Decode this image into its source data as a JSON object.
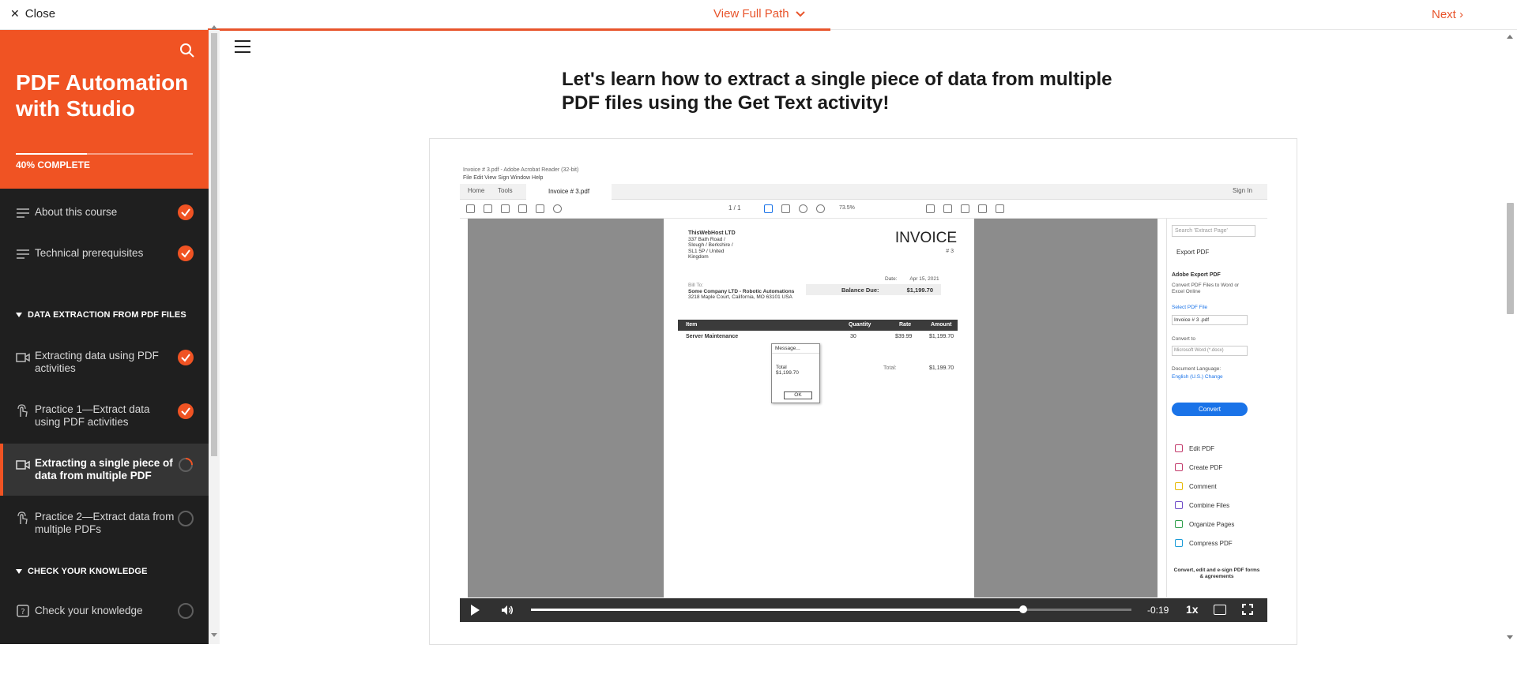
{
  "topbar": {
    "close_label": "Close",
    "view_full_path_label": "View Full Path",
    "next_label": "Next"
  },
  "course": {
    "title": "PDF Automation with Studio",
    "progress_label": "40% COMPLETE",
    "progress_fraction": 0.4
  },
  "sidebar": {
    "items": [
      {
        "label": "About this course",
        "status": "done",
        "icon": "lines-icon"
      },
      {
        "label": "Technical prerequisites",
        "status": "done",
        "icon": "lines-icon"
      },
      {
        "label": "Extracting data using PDF activities",
        "status": "done",
        "icon": "video-icon"
      },
      {
        "label": "Practice 1—Extract data using PDF activities",
        "status": "done",
        "icon": "hand-pointer-icon"
      },
      {
        "label": "Extracting a single piece of data from multiple PDF",
        "status": "in-progress",
        "icon": "video-icon"
      },
      {
        "label": "Practice 2—Extract data from multiple PDFs",
        "status": "open",
        "icon": "hand-pointer-icon"
      },
      {
        "label": "Check your knowledge",
        "status": "open",
        "icon": "quiz-icon"
      }
    ],
    "sections": [
      "DATA EXTRACTION FROM PDF FILES",
      "CHECK YOUR KNOWLEDGE"
    ]
  },
  "lesson": {
    "title": "Let's learn how to extract a single piece of data from multiple PDF files using the Get Text activity!"
  },
  "video": {
    "time_remaining": "-0:19",
    "speed": "1x",
    "progress_fraction": 0.82,
    "acrobat": {
      "window_title": "Invoice # 3.pdf - Adobe Acrobat Reader (32-bit)",
      "menu": "File  Edit  View  Sign  Window  Help",
      "tab_home": "Home",
      "tab_tools": "Tools",
      "tab_doc": "Invoice # 3.pdf",
      "sign_in": "Sign In",
      "page_indicator": "1 / 1",
      "zoom": "73.5%",
      "invoice_title": "INVOICE",
      "invoice_num": "# 3",
      "company_name": "ThisWebHost LTD",
      "company_addr": "337 Bath Road / Slough / Berkshire / SL1 5P / United Kingdom",
      "date_label": "Date:",
      "date_value": "Apr 15, 2021",
      "balance_label": "Balance Due:",
      "balance_value": "$1,199.70",
      "bill_to_label": "Bill To:",
      "bill_to_name": "Some Company LTD - Robotic Automations",
      "bill_to_addr": "3218 Maple Court, California, MO 63101 USA",
      "col_item": "Item",
      "col_qty": "Quantity",
      "col_rate": "Rate",
      "col_amount": "Amount",
      "row_item": "Server Maintenance",
      "row_qty": "30",
      "row_rate": "$39.99",
      "row_amount": "$1,199.70",
      "total_label": "Total:",
      "total_value": "$1,199.70",
      "msg_title": "Message...",
      "msg_body_1": "Total",
      "msg_body_2": "$1,199.70",
      "msg_ok": "OK",
      "side_search": "Search 'Extract Page'",
      "side_export": "Export PDF",
      "side_export_head": "Adobe Export PDF",
      "side_export_desc": "Convert PDF Files to Word or Excel Online",
      "side_select": "Select PDF File",
      "side_file": "Invoice # 3 .pdf",
      "side_convert_to": "Convert to",
      "side_format": "Microsoft Word (*.docx)",
      "side_lang": "Document Language:",
      "side_lang_val": "English (U.S.)  Change",
      "side_convert_btn": "Convert",
      "side_edit": "Edit PDF",
      "side_create": "Create PDF",
      "side_comment": "Comment",
      "side_combine": "Combine Files",
      "side_organize": "Organize Pages",
      "side_compress": "Compress PDF",
      "side_footer": "Convert, edit and e-sign PDF forms & agreements"
    }
  },
  "colors": {
    "accent": "#f05323",
    "sidebar_bg": "#1f1f1f"
  }
}
